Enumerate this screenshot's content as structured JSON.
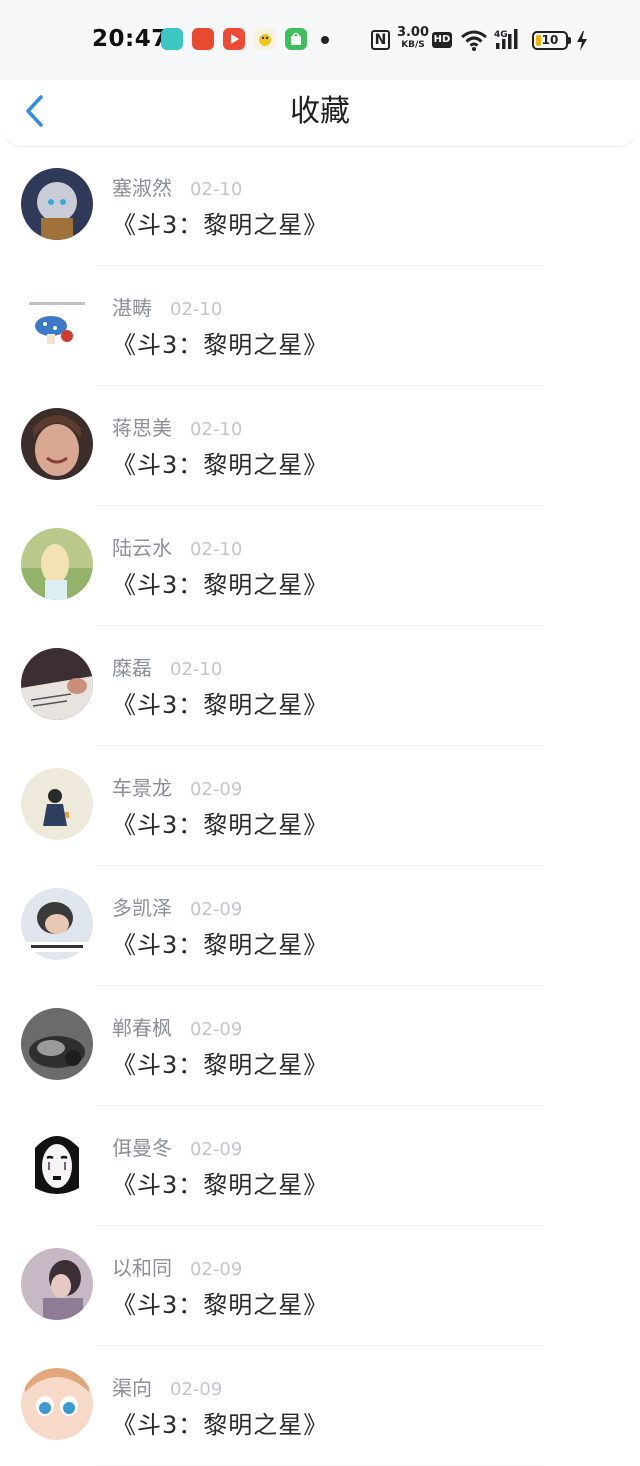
{
  "status_bar": {
    "time": "20:47",
    "speed_value": "3.00",
    "speed_unit": "KB/S",
    "hd_label": "HD",
    "network_label": "4G",
    "battery_level": "10",
    "colors": {
      "battery_fill": "#f0b400"
    }
  },
  "nav": {
    "title": "收藏",
    "back_icon": "chevron-left-icon",
    "accent": "#2f8ee8"
  },
  "favorites": [
    {
      "name": "塞淑然",
      "date": "02-10",
      "content": "《斗3：黎明之星》"
    },
    {
      "name": "湛畴",
      "date": "02-10",
      "content": "《斗3：黎明之星》"
    },
    {
      "name": "蒋思美",
      "date": "02-10",
      "content": "《斗3：黎明之星》"
    },
    {
      "name": "陆云水",
      "date": "02-10",
      "content": "《斗3：黎明之星》"
    },
    {
      "name": "糜磊",
      "date": "02-10",
      "content": "《斗3：黎明之星》"
    },
    {
      "name": "车景龙",
      "date": "02-09",
      "content": "《斗3：黎明之星》"
    },
    {
      "name": "多凯泽",
      "date": "02-09",
      "content": "《斗3：黎明之星》"
    },
    {
      "name": "郸春枫",
      "date": "02-09",
      "content": "《斗3：黎明之星》"
    },
    {
      "name": "佴曼冬",
      "date": "02-09",
      "content": "《斗3：黎明之星》"
    },
    {
      "name": "以和同",
      "date": "02-09",
      "content": "《斗3：黎明之星》"
    },
    {
      "name": "渠向",
      "date": "02-09",
      "content": "《斗3：黎明之星》"
    }
  ]
}
